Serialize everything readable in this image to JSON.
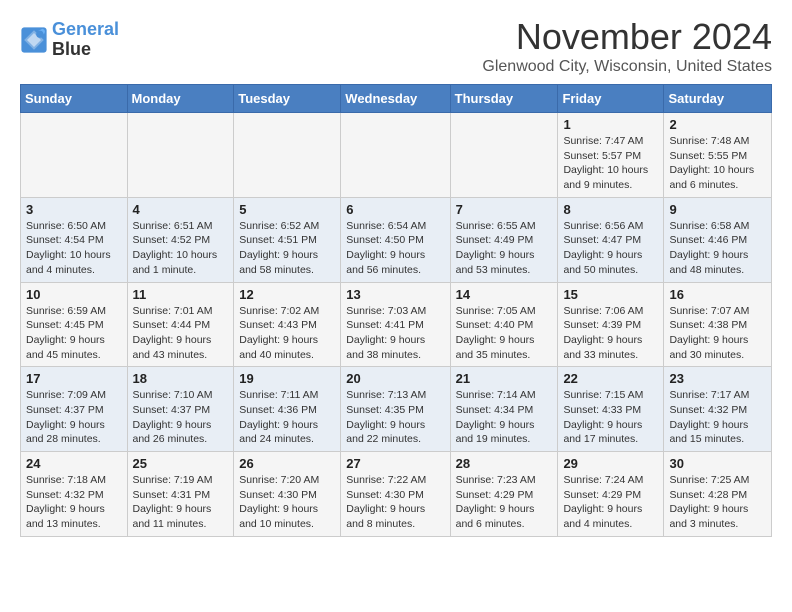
{
  "header": {
    "logo_line1": "General",
    "logo_line2": "Blue",
    "month_year": "November 2024",
    "location": "Glenwood City, Wisconsin, United States"
  },
  "days_of_week": [
    "Sunday",
    "Monday",
    "Tuesday",
    "Wednesday",
    "Thursday",
    "Friday",
    "Saturday"
  ],
  "weeks": [
    [
      {
        "day": "",
        "info": ""
      },
      {
        "day": "",
        "info": ""
      },
      {
        "day": "",
        "info": ""
      },
      {
        "day": "",
        "info": ""
      },
      {
        "day": "",
        "info": ""
      },
      {
        "day": "1",
        "info": "Sunrise: 7:47 AM\nSunset: 5:57 PM\nDaylight: 10 hours and 9 minutes."
      },
      {
        "day": "2",
        "info": "Sunrise: 7:48 AM\nSunset: 5:55 PM\nDaylight: 10 hours and 6 minutes."
      }
    ],
    [
      {
        "day": "3",
        "info": "Sunrise: 6:50 AM\nSunset: 4:54 PM\nDaylight: 10 hours and 4 minutes."
      },
      {
        "day": "4",
        "info": "Sunrise: 6:51 AM\nSunset: 4:52 PM\nDaylight: 10 hours and 1 minute."
      },
      {
        "day": "5",
        "info": "Sunrise: 6:52 AM\nSunset: 4:51 PM\nDaylight: 9 hours and 58 minutes."
      },
      {
        "day": "6",
        "info": "Sunrise: 6:54 AM\nSunset: 4:50 PM\nDaylight: 9 hours and 56 minutes."
      },
      {
        "day": "7",
        "info": "Sunrise: 6:55 AM\nSunset: 4:49 PM\nDaylight: 9 hours and 53 minutes."
      },
      {
        "day": "8",
        "info": "Sunrise: 6:56 AM\nSunset: 4:47 PM\nDaylight: 9 hours and 50 minutes."
      },
      {
        "day": "9",
        "info": "Sunrise: 6:58 AM\nSunset: 4:46 PM\nDaylight: 9 hours and 48 minutes."
      }
    ],
    [
      {
        "day": "10",
        "info": "Sunrise: 6:59 AM\nSunset: 4:45 PM\nDaylight: 9 hours and 45 minutes."
      },
      {
        "day": "11",
        "info": "Sunrise: 7:01 AM\nSunset: 4:44 PM\nDaylight: 9 hours and 43 minutes."
      },
      {
        "day": "12",
        "info": "Sunrise: 7:02 AM\nSunset: 4:43 PM\nDaylight: 9 hours and 40 minutes."
      },
      {
        "day": "13",
        "info": "Sunrise: 7:03 AM\nSunset: 4:41 PM\nDaylight: 9 hours and 38 minutes."
      },
      {
        "day": "14",
        "info": "Sunrise: 7:05 AM\nSunset: 4:40 PM\nDaylight: 9 hours and 35 minutes."
      },
      {
        "day": "15",
        "info": "Sunrise: 7:06 AM\nSunset: 4:39 PM\nDaylight: 9 hours and 33 minutes."
      },
      {
        "day": "16",
        "info": "Sunrise: 7:07 AM\nSunset: 4:38 PM\nDaylight: 9 hours and 30 minutes."
      }
    ],
    [
      {
        "day": "17",
        "info": "Sunrise: 7:09 AM\nSunset: 4:37 PM\nDaylight: 9 hours and 28 minutes."
      },
      {
        "day": "18",
        "info": "Sunrise: 7:10 AM\nSunset: 4:37 PM\nDaylight: 9 hours and 26 minutes."
      },
      {
        "day": "19",
        "info": "Sunrise: 7:11 AM\nSunset: 4:36 PM\nDaylight: 9 hours and 24 minutes."
      },
      {
        "day": "20",
        "info": "Sunrise: 7:13 AM\nSunset: 4:35 PM\nDaylight: 9 hours and 22 minutes."
      },
      {
        "day": "21",
        "info": "Sunrise: 7:14 AM\nSunset: 4:34 PM\nDaylight: 9 hours and 19 minutes."
      },
      {
        "day": "22",
        "info": "Sunrise: 7:15 AM\nSunset: 4:33 PM\nDaylight: 9 hours and 17 minutes."
      },
      {
        "day": "23",
        "info": "Sunrise: 7:17 AM\nSunset: 4:32 PM\nDaylight: 9 hours and 15 minutes."
      }
    ],
    [
      {
        "day": "24",
        "info": "Sunrise: 7:18 AM\nSunset: 4:32 PM\nDaylight: 9 hours and 13 minutes."
      },
      {
        "day": "25",
        "info": "Sunrise: 7:19 AM\nSunset: 4:31 PM\nDaylight: 9 hours and 11 minutes."
      },
      {
        "day": "26",
        "info": "Sunrise: 7:20 AM\nSunset: 4:30 PM\nDaylight: 9 hours and 10 minutes."
      },
      {
        "day": "27",
        "info": "Sunrise: 7:22 AM\nSunset: 4:30 PM\nDaylight: 9 hours and 8 minutes."
      },
      {
        "day": "28",
        "info": "Sunrise: 7:23 AM\nSunset: 4:29 PM\nDaylight: 9 hours and 6 minutes."
      },
      {
        "day": "29",
        "info": "Sunrise: 7:24 AM\nSunset: 4:29 PM\nDaylight: 9 hours and 4 minutes."
      },
      {
        "day": "30",
        "info": "Sunrise: 7:25 AM\nSunset: 4:28 PM\nDaylight: 9 hours and 3 minutes."
      }
    ]
  ]
}
